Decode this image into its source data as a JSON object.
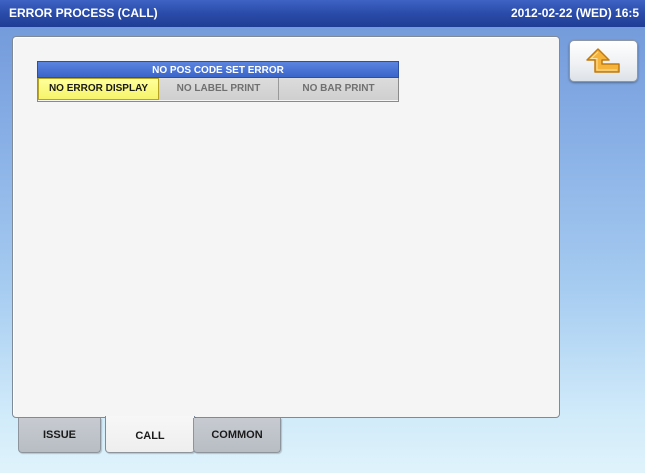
{
  "header": {
    "title": "ERROR PROCESS (CALL)",
    "datetime": "2012-02-22 (WED) 16:5"
  },
  "section": {
    "title": "NO POS CODE SET ERROR",
    "options": [
      {
        "label": "NO ERROR DISPLAY",
        "selected": true
      },
      {
        "label": "NO LABEL PRINT",
        "selected": false
      },
      {
        "label": "NO BAR PRINT",
        "selected": false
      }
    ]
  },
  "back_button": {
    "icon": "return-arrow-icon"
  },
  "tabs": [
    {
      "label": "ISSUE",
      "active": false
    },
    {
      "label": "CALL",
      "active": true
    },
    {
      "label": "COMMON",
      "active": false
    }
  ],
  "colors": {
    "title_bar": "#2a4ba9",
    "section_header": "#3a65c9",
    "selected_option": "#f6f46a",
    "arrow_icon": "#f0a41e"
  }
}
